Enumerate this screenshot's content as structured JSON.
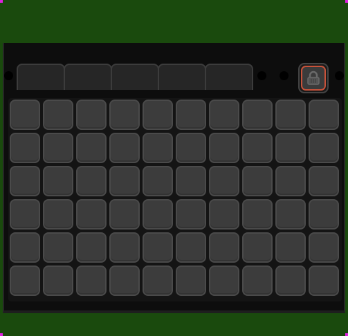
{
  "colors": {
    "background": "#1a4a0d",
    "panel": "#0d0d0d",
    "slot": "#3c3c3c",
    "lock_accent": "#c8523a"
  },
  "tabs": [
    {
      "name": "tab-1",
      "label": ""
    },
    {
      "name": "tab-2",
      "label": ""
    },
    {
      "name": "tab-3",
      "label": ""
    },
    {
      "name": "tab-4",
      "label": ""
    },
    {
      "name": "tab-5",
      "label": ""
    }
  ],
  "lock_button": {
    "icon": "lock-icon"
  },
  "inventory": {
    "rows": 6,
    "columns": 10
  }
}
